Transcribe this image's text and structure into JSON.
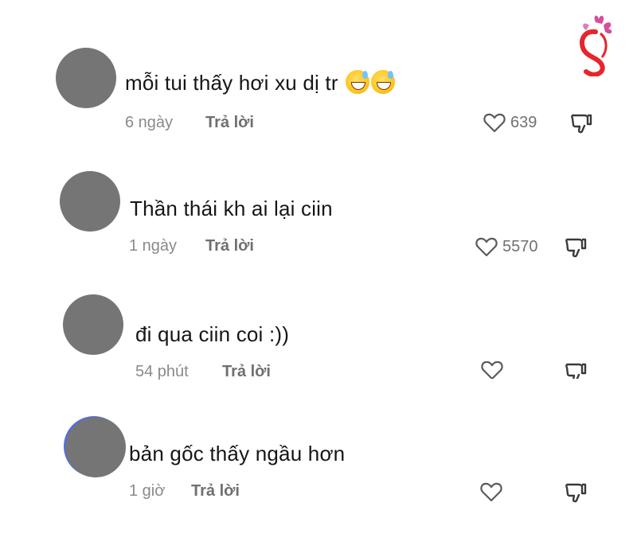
{
  "comments": [
    {
      "text": "mỗi tui thấy hơi xu dị tr",
      "emoji": [
        "grinning-sweat-emoji",
        "grinning-sweat-emoji"
      ],
      "time": "6 ngày",
      "reply_label": "Trả lời",
      "likes": "639"
    },
    {
      "text": "Thần thái kh ai lại ciin",
      "time": "1 ngày",
      "reply_label": "Trả lời",
      "likes": "5570"
    },
    {
      "text": "đi qua ciin coi :))",
      "time": "54 phút",
      "reply_label": "Trả lời",
      "likes": ""
    },
    {
      "text": "bản gốc thấy ngầu hơn",
      "time": "1 giờ",
      "reply_label": "Trả lời",
      "likes": ""
    }
  ],
  "colors": {
    "text": "#161616",
    "meta": "#8a8a8a",
    "avatar": "#757575",
    "logo": "#e6252c"
  },
  "icons": {
    "like": "heart-outline-icon",
    "dislike": "thumbs-down-outline-icon",
    "logo": "woman-profile-flower-logo"
  }
}
